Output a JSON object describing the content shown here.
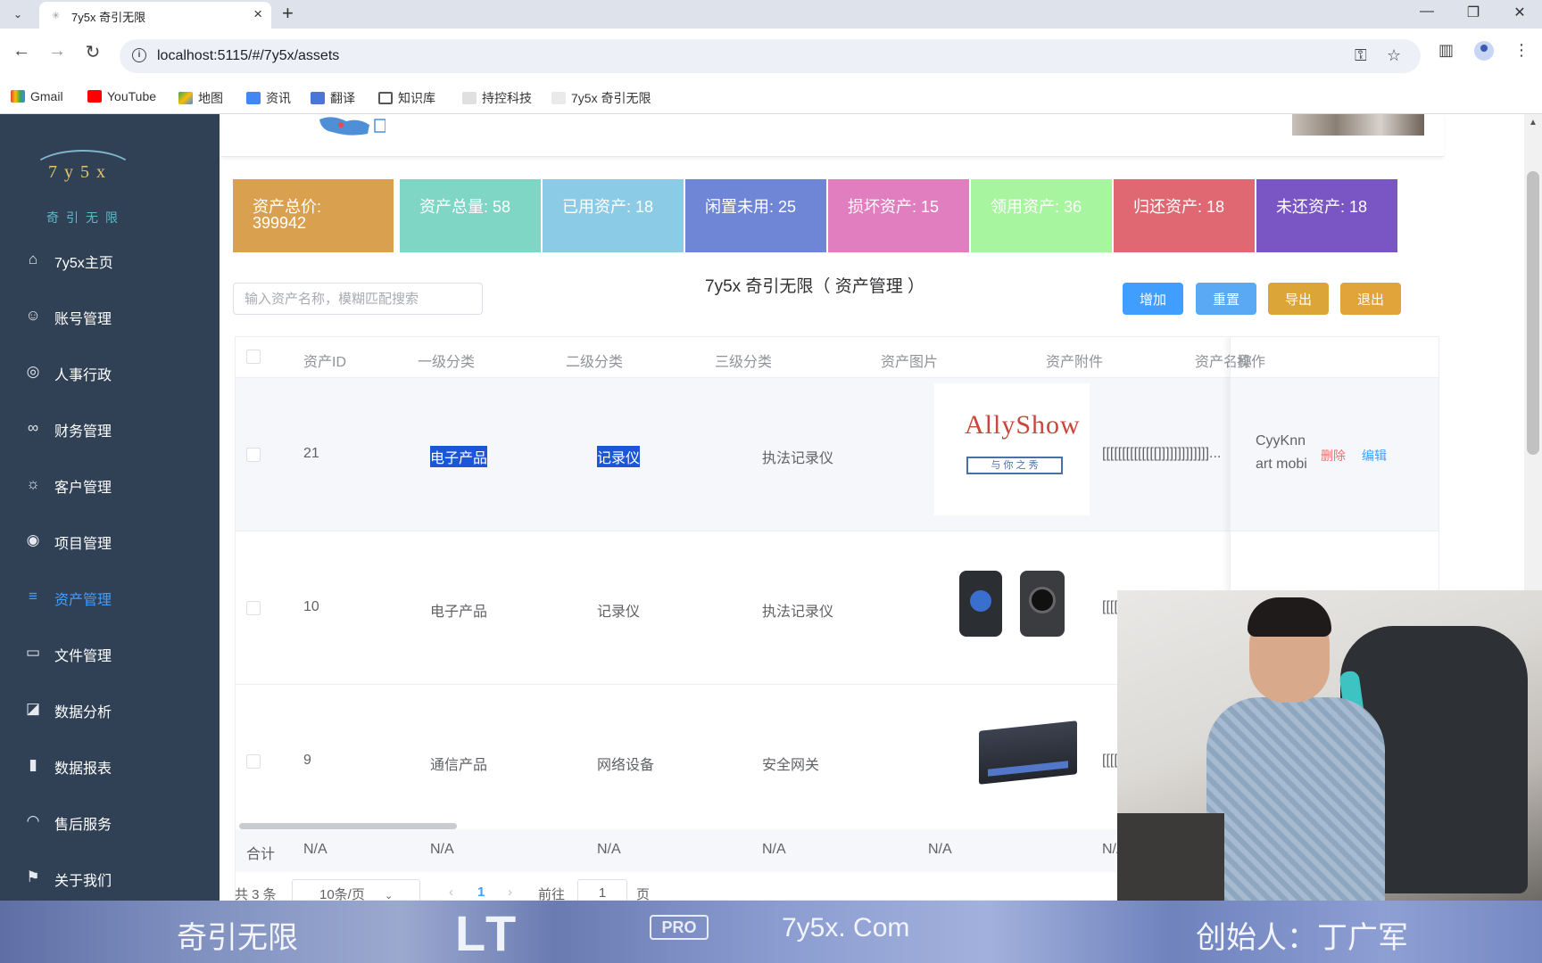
{
  "browser": {
    "tab_title": "7y5x 奇引无限",
    "url": "localhost:5115/#/7y5x/assets",
    "bookmarks": [
      "Gmail",
      "YouTube",
      "地图",
      "资讯",
      "翻译",
      "知识库",
      "持控科技",
      "7y5x 奇引无限"
    ]
  },
  "sidebar": {
    "logo_text": "7y5x",
    "logo_sub": "奇引无限",
    "items": [
      {
        "label": "7y5x主页",
        "icon": "home-icon"
      },
      {
        "label": "账号管理",
        "icon": "user-icon"
      },
      {
        "label": "人事行政",
        "icon": "circle-icon"
      },
      {
        "label": "财务管理",
        "icon": "link-icon"
      },
      {
        "label": "客户管理",
        "icon": "sun-icon"
      },
      {
        "label": "项目管理",
        "icon": "project-icon"
      },
      {
        "label": "资产管理",
        "icon": "list-icon",
        "active": true
      },
      {
        "label": "文件管理",
        "icon": "folder-icon"
      },
      {
        "label": "数据分析",
        "icon": "line-chart-icon"
      },
      {
        "label": "数据报表",
        "icon": "bar-chart-icon"
      },
      {
        "label": "售后服务",
        "icon": "headset-icon"
      },
      {
        "label": "关于我们",
        "icon": "flag-icon"
      }
    ]
  },
  "stats": [
    {
      "label": "资产总价:",
      "value": "399942",
      "color": "#d9a050"
    },
    {
      "label": "资产总量: 58",
      "color": "#7fd6c4"
    },
    {
      "label": "已用资产: 18",
      "color": "#8ccbe6"
    },
    {
      "label": "闲置未用: 25",
      "color": "#6f86d6"
    },
    {
      "label": "损坏资产: 15",
      "color": "#e07ec0"
    },
    {
      "label": "领用资产: 36",
      "color": "#a8f5a0"
    },
    {
      "label": "归还资产: 18",
      "color": "#e06872"
    },
    {
      "label": "未还资产: 18",
      "color": "#7a55c4"
    }
  ],
  "toolbar": {
    "search_placeholder": "输入资产名称，模糊匹配搜索",
    "title": "7y5x 奇引无限（ 资产管理 ）",
    "add": "增加",
    "reset": "重置",
    "export": "导出",
    "logout": "退出"
  },
  "colors": {
    "primary": "#409eff",
    "warning": "#e6a23c",
    "danger": "#f56c6c"
  },
  "table": {
    "headers": [
      "资产ID",
      "一级分类",
      "二级分类",
      "三级分类",
      "资产图片",
      "资产附件",
      "资产名称",
      "操作"
    ],
    "rows": [
      {
        "id": "21",
        "cat1": "电子产品",
        "cat2": "记录仪",
        "cat3": "执法记录仪",
        "attachment": "[[[[[[[[[[[[[[]]]]]]]]]]]]]...",
        "name_line1": "CyyKnn",
        "name_line2": "art mobi",
        "delete": "删除",
        "edit": "编辑",
        "logo_text": "AllyShow",
        "logo_sub": "与 你 之 秀"
      },
      {
        "id": "10",
        "cat1": "电子产品",
        "cat2": "记录仪",
        "cat3": "执法记录仪",
        "attachment": "[[[["
      },
      {
        "id": "9",
        "cat1": "通信产品",
        "cat2": "网络设备",
        "cat3": "安全网关",
        "attachment": "[[[["
      }
    ],
    "summary": [
      "合计",
      "N/A",
      "N/A",
      "N/A",
      "N/A",
      "N/A",
      "N/A"
    ]
  },
  "pager": {
    "total": "共 3 条",
    "size": "10条/页",
    "current": "1",
    "goto": "前往",
    "goto_value": "1",
    "page": "页"
  },
  "banner": {
    "left": "奇引无限",
    "center": "7y5x. Com",
    "right": "创始人：丁广军",
    "pro": "PRO",
    "lt": "LT"
  }
}
